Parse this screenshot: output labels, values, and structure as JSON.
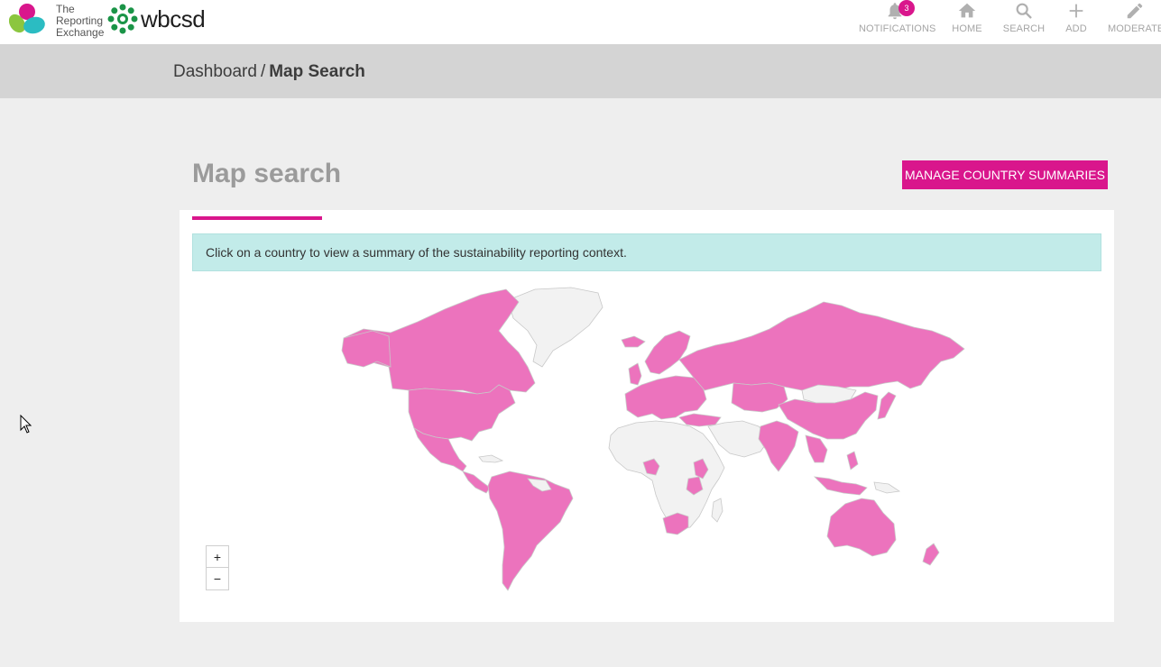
{
  "header": {
    "logo_rex_lines": [
      "The",
      "Reporting",
      "Exchange"
    ],
    "logo_wbcsd": "wbcsd",
    "nav": [
      {
        "id": "notifications",
        "label": "NOTIFICATIONS",
        "icon": "bell-icon",
        "badge": "3"
      },
      {
        "id": "home",
        "label": "HOME",
        "icon": "home-icon"
      },
      {
        "id": "search",
        "label": "SEARCH",
        "icon": "search-icon"
      },
      {
        "id": "add",
        "label": "ADD",
        "icon": "plus-icon"
      },
      {
        "id": "moderate",
        "label": "MODERATE",
        "icon": "pencil-icon"
      }
    ]
  },
  "breadcrumb": {
    "parent": "Dashboard",
    "separator": "/",
    "current": "Map Search"
  },
  "page": {
    "title": "Map search",
    "manage_button": "MANAGE COUNTRY SUMMARIES",
    "info_text": "Click on a country to view a summary of the sustainability reporting context."
  },
  "map": {
    "highlight_color": "#ec73bd",
    "base_color": "#f2f2f2",
    "border_color": "#c8c8c8",
    "zoom_in": "+",
    "zoom_out": "−"
  },
  "colors": {
    "accent": "#d9168c",
    "info_bg": "#c2ebe9"
  }
}
